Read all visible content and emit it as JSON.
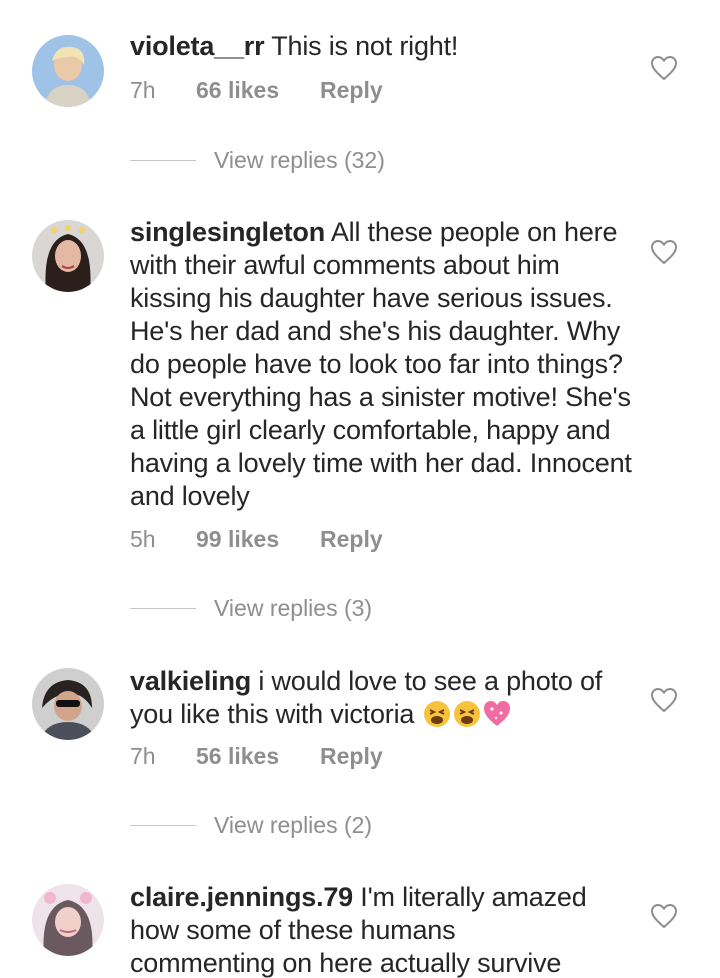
{
  "comments": [
    {
      "username": "violeta__rr",
      "text": " This is not right!",
      "time": "7h",
      "likes": "66 likes",
      "reply": "Reply",
      "view_replies": "View replies (32)"
    },
    {
      "username": "singlesingleton",
      "text": " All these people on here with their awful comments about him kissing his daughter have serious issues. He's her dad and she's his daughter. Why do people have to look too far into things? Not everything has a sinister motive!  She's a little girl clearly comfortable, happy and having a lovely time with her dad. Innocent and lovely",
      "time": "5h",
      "likes": "99 likes",
      "reply": "Reply",
      "view_replies": "View replies (3)"
    },
    {
      "username": "valkieling",
      "text": " i would love to see a photo of you like this with victoria ",
      "emojis": [
        "tired-face-emoji",
        "tired-face-emoji",
        "sparkling-heart-emoji"
      ],
      "time": "7h",
      "likes": "56 likes",
      "reply": "Reply",
      "view_replies": "View replies (2)"
    },
    {
      "username": "claire.jennings.79",
      "text": " I'm literally amazed how some of these humans commenting on here actually survive"
    }
  ],
  "icons": {
    "like": "heart-outline-icon"
  },
  "colors": {
    "text": "#262626",
    "secondary": "#8e8e8e",
    "divider": "#c7c7c7"
  }
}
